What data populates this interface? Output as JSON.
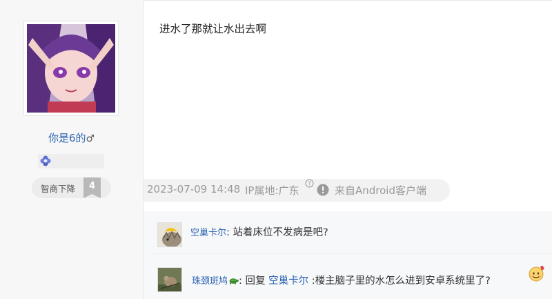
{
  "author": {
    "name": "你是6的",
    "gender_symbol": "♂",
    "level_title": "智商下降",
    "level_number": "4"
  },
  "post": {
    "content": "进水了那就让水出去啊",
    "date": "2023-07-09 14:48",
    "ip_location": "IP属地:广东",
    "source": "来自Android客户端"
  },
  "comments": [
    {
      "user": "空巢卡尔",
      "separator": ":",
      "text": " 站着床位不发病是吧?"
    },
    {
      "user": "珠颈斑鸠",
      "separator": ":",
      "reply_prefix": " 回复 ",
      "reply_target": "空巢卡尔",
      "text": " :楼主脑子里的水怎么进到安卓系统里了?"
    }
  ],
  "icons": {
    "badge": "flower-badge-icon",
    "help": "question-circle-icon",
    "report": "exclamation-circle-icon",
    "turtle": "turtle-icon",
    "emoji": "smiley-emoji-icon"
  },
  "colors": {
    "link": "#2d64b3",
    "meta_text": "#9a9a9a",
    "left_bg": "#f7f7f7"
  }
}
